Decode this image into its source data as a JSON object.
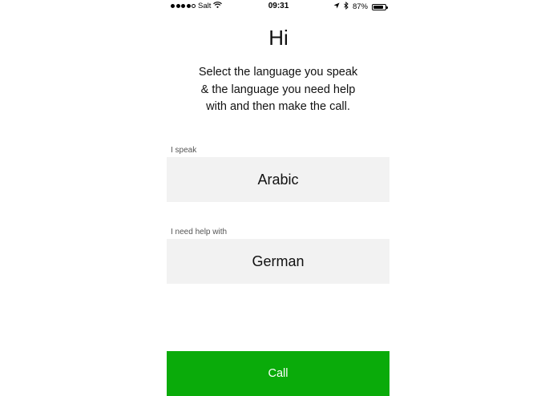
{
  "status_bar": {
    "carrier": "Salt",
    "time": "09:31",
    "battery_percent": "87%",
    "battery_level": 0.87,
    "signal_bars_filled": 4,
    "signal_bars_total": 5,
    "icons": [
      "wifi-icon",
      "location-icon",
      "bluetooth-icon",
      "battery-icon"
    ]
  },
  "main": {
    "title": "Hi",
    "instructions": "Select the language you speak & the language you need help with and then make the call."
  },
  "speak_field": {
    "label": "I speak",
    "value": "Arabic"
  },
  "help_field": {
    "label": "I need help with",
    "value": "German"
  },
  "call_button": {
    "label": "Call"
  },
  "colors": {
    "accent": "#0aab0a",
    "field_background": "#f2f2f2",
    "background": "#ffffff"
  }
}
